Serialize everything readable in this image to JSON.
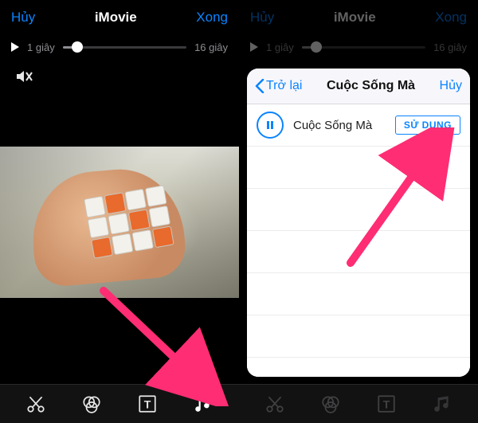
{
  "app": {
    "title": "iMovie"
  },
  "nav": {
    "cancel": "Hủy",
    "done": "Xong"
  },
  "scrub": {
    "current": "1 giây",
    "total": "16 giây",
    "progress_pct": 12
  },
  "sheet": {
    "back_label": "Trở lại",
    "title": "Cuộc Sống Mà",
    "cancel": "Hủy",
    "song": {
      "name": "Cuộc Sống Mà",
      "use_label": "SỬ DỤNG"
    }
  },
  "tools": {
    "cut": "cut-tool",
    "filters": "filters-tool",
    "text": "text-tool",
    "music": "music-tool"
  },
  "icons": {
    "mute": "mute-icon",
    "play": "play-icon",
    "pause": "pause-icon",
    "chevron_left": "chevron-left-icon"
  },
  "colors": {
    "accent": "#0a84ff",
    "arrow": "#ff2d73"
  }
}
